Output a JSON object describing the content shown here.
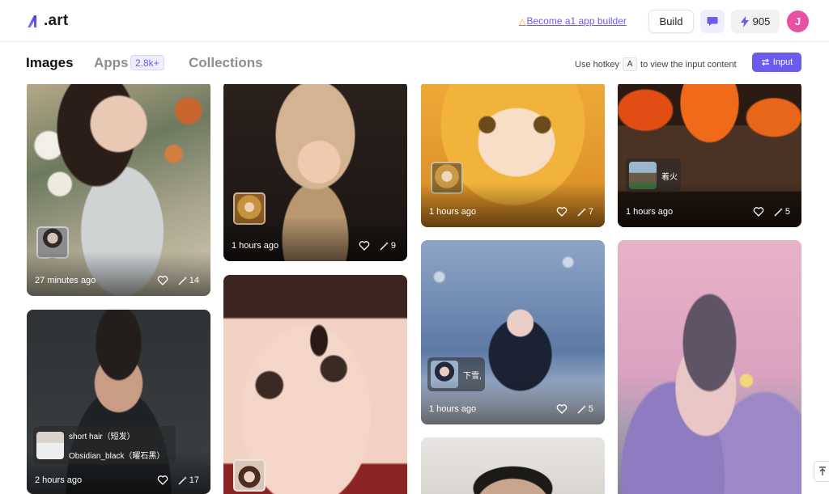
{
  "header": {
    "logo_text": ".art",
    "builder_link": "Become a1 app builder",
    "build_label": "Build",
    "credits": "905",
    "avatar_initial": "J"
  },
  "tabs": {
    "images": "Images",
    "apps": "Apps",
    "apps_count": "2.8k+",
    "collections": "Collections"
  },
  "hotkey": {
    "prefix": "Use hotkey",
    "key": "A",
    "suffix": "to view the input content",
    "input_label": "Input"
  },
  "colors": {
    "accent": "#6b5cf0",
    "avatar": "#e94fa3"
  },
  "cards": [
    {
      "time": "27 minutes ago",
      "remixes": "14"
    },
    {
      "time": "2 hours ago",
      "remixes": "17",
      "label_line1": "short hair（短发）",
      "label_line2": "Obsidian_black（曜石黑）"
    },
    {
      "time": "1 hours ago",
      "remixes": "9"
    },
    {
      "time": "1 hours ago",
      "remixes": "7"
    },
    {
      "time": "1 hours ago",
      "remixes": "5",
      "label": "下雪,"
    },
    {
      "time": "1 hours ago",
      "remixes": "5",
      "label": "着火"
    }
  ]
}
